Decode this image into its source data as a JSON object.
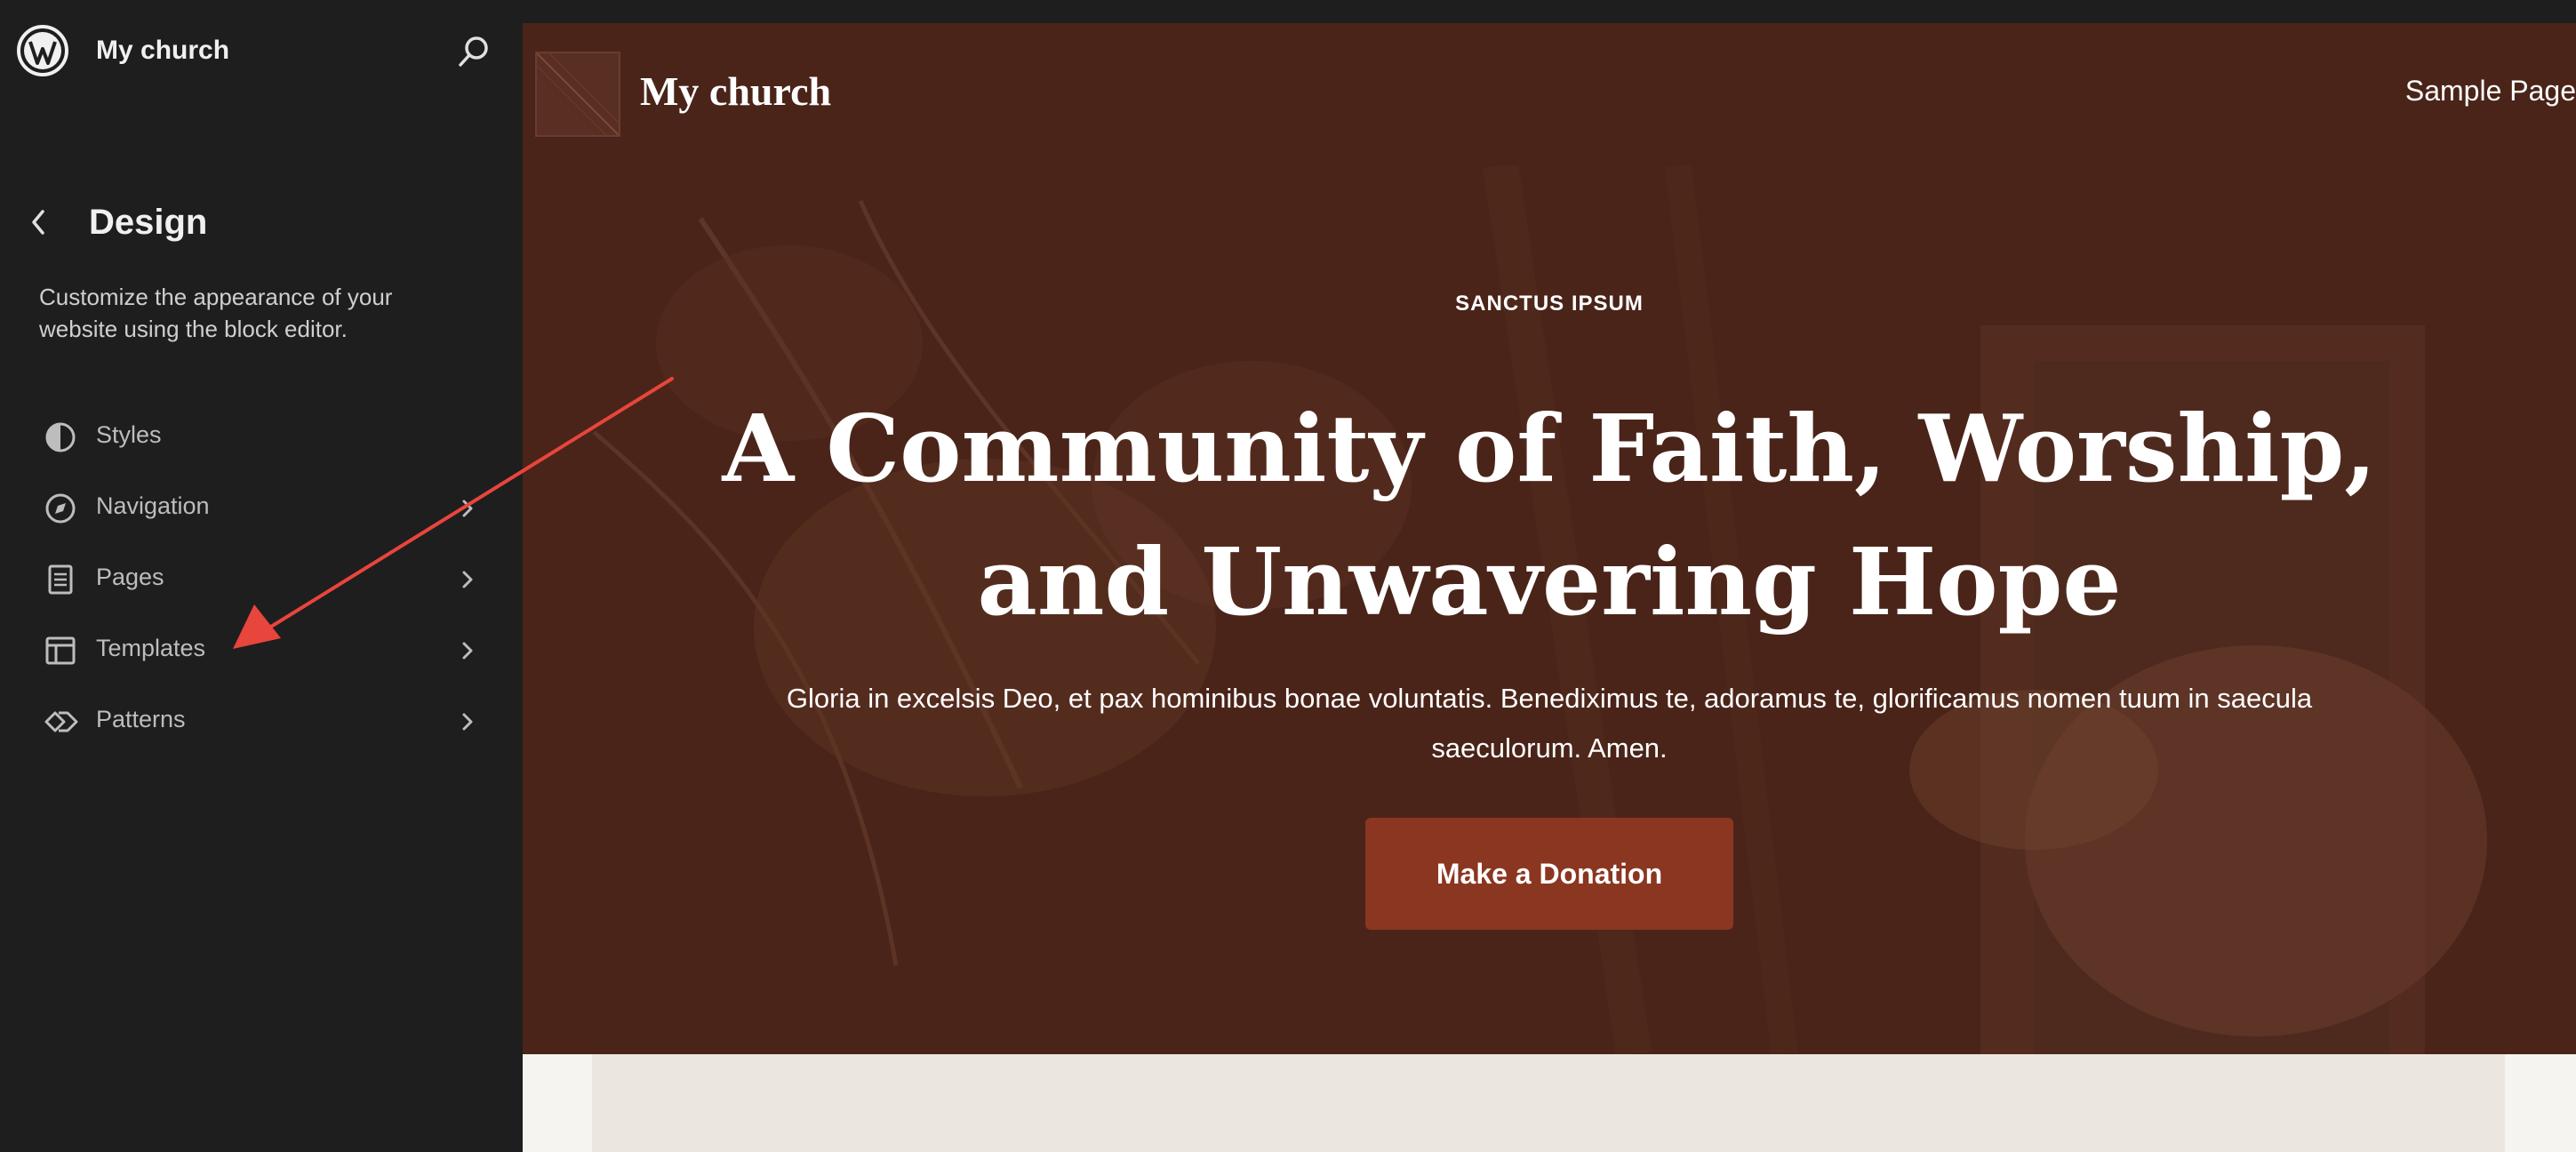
{
  "app": {
    "site_title": "My church"
  },
  "sidebar": {
    "back_label": "Back",
    "title": "Design",
    "description": "Customize the appearance of your website using the block editor.",
    "items": [
      {
        "label": "Styles",
        "icon": "styles-icon",
        "has_chevron": false
      },
      {
        "label": "Navigation",
        "icon": "navigation-icon",
        "has_chevron": true
      },
      {
        "label": "Pages",
        "icon": "pages-icon",
        "has_chevron": true
      },
      {
        "label": "Templates",
        "icon": "templates-icon",
        "has_chevron": true
      },
      {
        "label": "Patterns",
        "icon": "patterns-icon",
        "has_chevron": true
      }
    ]
  },
  "preview": {
    "site_title": "My church",
    "nav_link": "Sample Page",
    "hero": {
      "eyebrow": "SANCTUS IPSUM",
      "heading": "A Community of Faith, Worship, and Unwavering Hope",
      "subtext": "Gloria in excelsis Deo, et pax hominibus bonae voluntatis. Benediximus te, adoramus te, glorificamus nomen tuum in saecula saeculorum. Amen.",
      "button_label": "Make a Donation"
    }
  },
  "colors": {
    "sidebar_bg": "#1e1e1e",
    "hero_bg": "#4a2419",
    "button_bg": "#8a3620",
    "annotation_arrow": "#e8453c"
  }
}
